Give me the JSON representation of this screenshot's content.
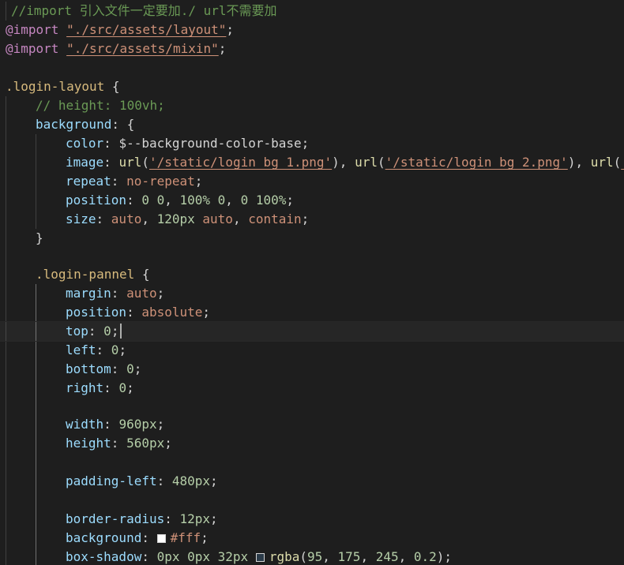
{
  "editor": {
    "language": "scss",
    "colors": {
      "background": "#1e1e1e",
      "comment": "#6a9955",
      "at_rule": "#c586c0",
      "string": "#ce9178",
      "selector": "#d7ba7d",
      "property": "#9cdcfe",
      "number": "#b5cea8"
    },
    "lines": {
      "l1": {
        "comment": "//import 引入文件一定要加./ url不需要加"
      },
      "l2": {
        "at": "@import",
        "str": "\"./src/assets/layout\"",
        "end": ";"
      },
      "l3": {
        "at": "@import",
        "str": "\"./src/assets/mixin\"",
        "end": ";"
      },
      "l5": {
        "sel": ".login-layout",
        "brace": " {"
      },
      "l6": {
        "comment": "// height: 100vh;"
      },
      "l7": {
        "prop": "background",
        "rest": ": {"
      },
      "l8": {
        "prop": "color",
        "colon": ": ",
        "var": "$--background-color-base",
        "end": ";"
      },
      "l9": {
        "prop": "image",
        "colon": ": ",
        "fn1": "url",
        "open1": "(",
        "url1": "'/static/login_bg_1.png'",
        "close1": "), ",
        "fn2": "url",
        "open2": "(",
        "url2": "'/static/login_bg_2.png'",
        "close2": "), ",
        "fn3": "url",
        "open3": "(",
        "url3": "'"
      },
      "l10": {
        "prop": "repeat",
        "colon": ": ",
        "kw": "no-repeat",
        "end": ";"
      },
      "l11": {
        "prop": "position",
        "colon": ": ",
        "n1": "0 0",
        "s1": ", ",
        "n2": "100% 0",
        "s2": ", ",
        "n3": "0 100%",
        "end": ";"
      },
      "l12": {
        "prop": "size",
        "colon": ": ",
        "k1": "auto",
        "s1": ", ",
        "n1": "120px",
        "sp": " ",
        "k2": "auto",
        "s2": ", ",
        "k3": "contain",
        "end": ";"
      },
      "l13": {
        "brace": "}"
      },
      "l15": {
        "sel": ".login-pannel",
        "brace": " {"
      },
      "l16": {
        "prop": "margin",
        "colon": ": ",
        "kw": "auto",
        "end": ";"
      },
      "l17": {
        "prop": "position",
        "colon": ": ",
        "kw": "absolute",
        "end": ";"
      },
      "l18": {
        "prop": "top",
        "colon": ": ",
        "num": "0",
        "end": ";"
      },
      "l19": {
        "prop": "left",
        "colon": ": ",
        "num": "0",
        "end": ";"
      },
      "l20": {
        "prop": "bottom",
        "colon": ": ",
        "num": "0",
        "end": ";"
      },
      "l21": {
        "prop": "right",
        "colon": ": ",
        "num": "0",
        "end": ";"
      },
      "l23": {
        "prop": "width",
        "colon": ": ",
        "num": "960px",
        "end": ";"
      },
      "l24": {
        "prop": "height",
        "colon": ": ",
        "num": "560px",
        "end": ";"
      },
      "l26": {
        "prop": "padding-left",
        "colon": ": ",
        "num": "480px",
        "end": ";"
      },
      "l28": {
        "prop": "border-radius",
        "colon": ": ",
        "num": "12px",
        "end": ";"
      },
      "l29": {
        "prop": "background",
        "colon": ": ",
        "swatch": "#ffffff",
        "kw": "#fff",
        "end": ";"
      },
      "l30": {
        "prop": "box-shadow",
        "colon": ": ",
        "num": "0px 0px 32px",
        "sp": " ",
        "swatch": "rgba(95,175,245,0.2)",
        "fn": "rgba",
        "open": "(",
        "n1": "95",
        "s1": ", ",
        "n2": "175",
        "s2": ", ",
        "n3": "245",
        "s3": ", ",
        "n4": "0.2",
        "close": ")",
        "end": ";"
      }
    }
  }
}
